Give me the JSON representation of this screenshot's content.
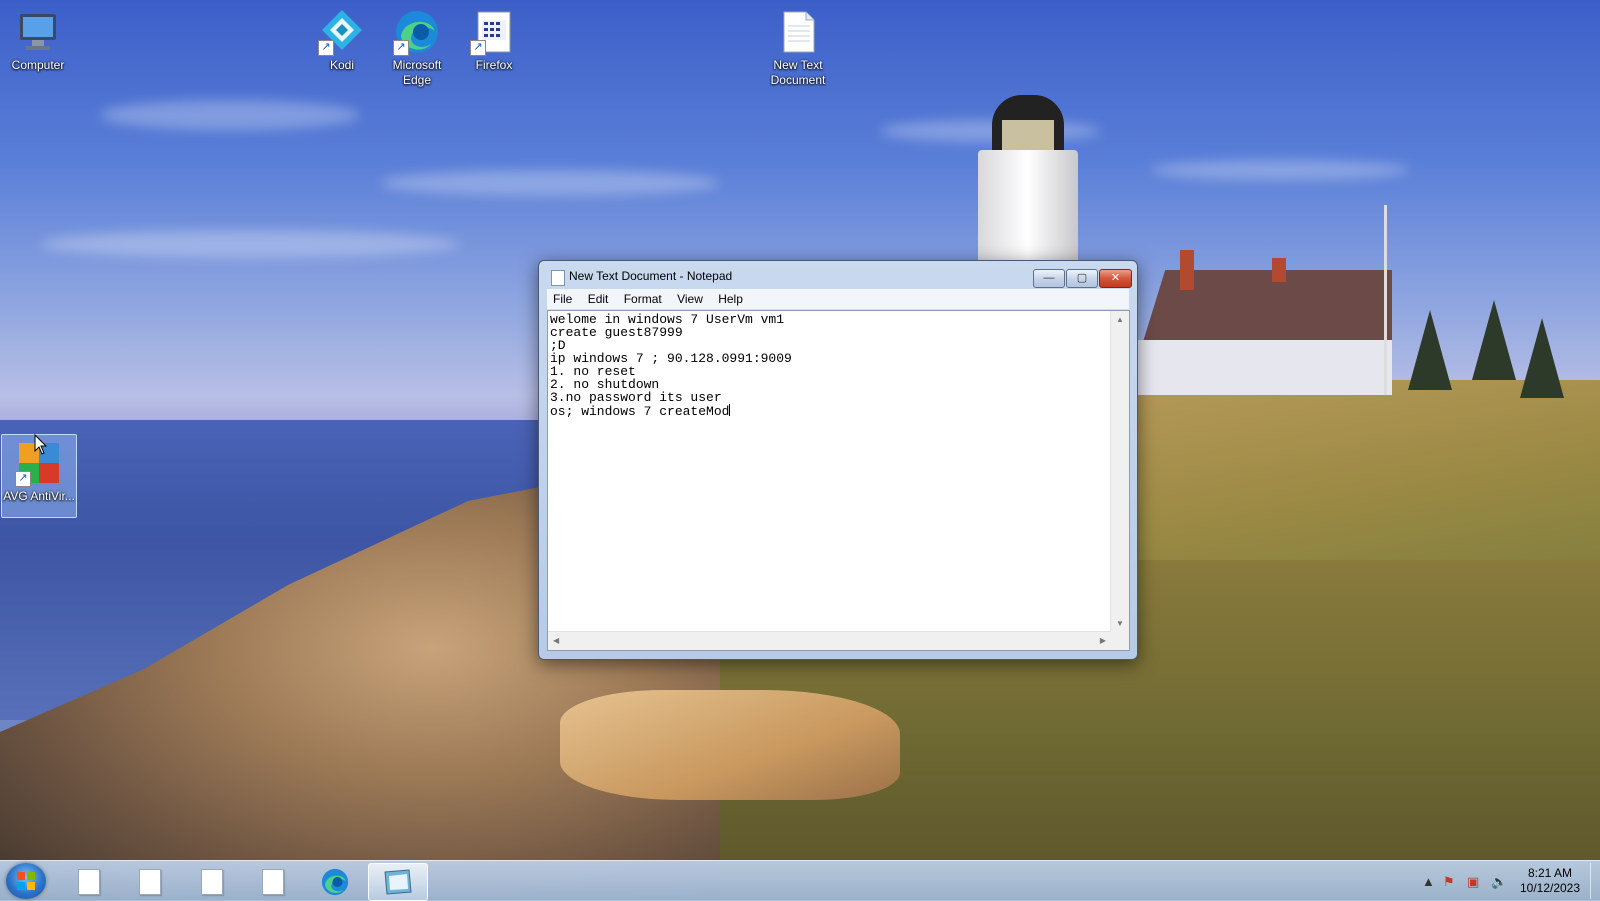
{
  "desktop": {
    "icons": [
      {
        "label": "Computer"
      },
      {
        "label": "Kodi"
      },
      {
        "label": "Microsoft Edge"
      },
      {
        "label": "Firefox"
      },
      {
        "label": "New Text Document"
      },
      {
        "label": "AVG AntiVir..."
      }
    ]
  },
  "notepad": {
    "title": "New Text Document - Notepad",
    "menu": [
      "File",
      "Edit",
      "Format",
      "View",
      "Help"
    ],
    "content": "welome in windows 7 UserVm vm1\ncreate guest87999\n;D\nip windows 7 ; 90.128.0991:9009\n1. no reset\n2. no shutdown\n3.no password its user\nos; windows 7 createMod",
    "controls": {
      "minimize": "—",
      "maximize": "▢",
      "close": "✕"
    }
  },
  "taskbar": {
    "time": "8:21 AM",
    "date": "10/12/2023"
  },
  "colors": {
    "taskbar": "#a8bfdb",
    "close_button": "#c8432a",
    "accent": "#2c74c8"
  }
}
